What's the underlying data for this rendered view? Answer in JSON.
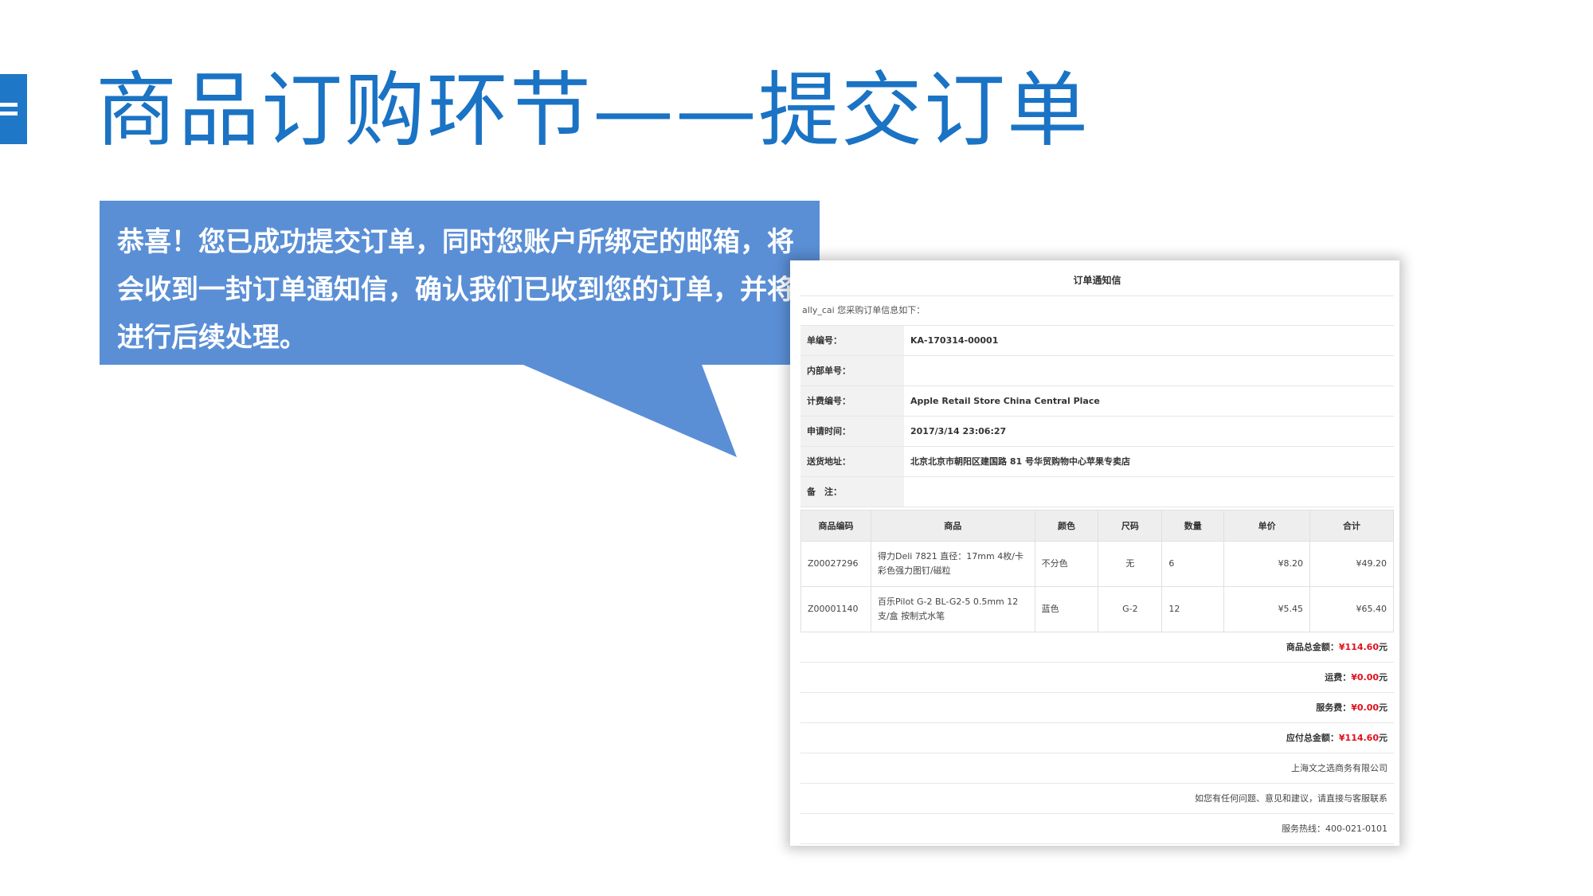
{
  "slide": {
    "title": "商品订购环节——提交订单",
    "callout": "恭喜！您已成功提交订单，同时您账户所绑定的邮箱，将会收到一封订单通知信，确认我们已收到您的订单，并将进行后续处理。",
    "accent_color": "#1f77c8",
    "callout_color": "#5a8fd6"
  },
  "email": {
    "title": "订单通知信",
    "greeting": "ally_cai 您采购订单信息如下：",
    "info": [
      {
        "label": "单编号：",
        "value": "KA-170314-00001"
      },
      {
        "label": "内部单号：",
        "value": ""
      },
      {
        "label": "计费编号：",
        "value": "Apple Retail Store China Central Place"
      },
      {
        "label": "申请时间：",
        "value": "2017/3/14 23:06:27"
      },
      {
        "label": "送货地址：",
        "value": "北京北京市朝阳区建国路 81 号华贸购物中心苹果专卖店"
      },
      {
        "label": "备　注：",
        "value": ""
      }
    ],
    "columns": [
      "商品编码",
      "商品",
      "颜色",
      "尺码",
      "数量",
      "单价",
      "合计"
    ],
    "rows": [
      {
        "code": "Z00027296",
        "name": "得力Deli 7821 直径：17mm 4枚/卡 彩色强力图钉/磁粒",
        "color": "不分色",
        "size": "无",
        "qty": "6",
        "price": "¥8.20",
        "total": "¥49.20"
      },
      {
        "code": "Z00001140",
        "name": "百乐Pilot G-2 BL-G2-5 0.5mm 12支/盒 按制式水笔",
        "color": "蓝色",
        "size": "G-2",
        "qty": "12",
        "price": "¥5.45",
        "total": "¥65.40"
      }
    ],
    "summary": [
      {
        "label": "商品总金额：",
        "amount": "¥114.60",
        "unit": "元"
      },
      {
        "label": "运费：",
        "amount": "¥0.00",
        "unit": "元"
      },
      {
        "label": "服务费：",
        "amount": "¥0.00",
        "unit": "元"
      },
      {
        "label": "应付总金额：",
        "amount": "¥114.60",
        "unit": "元"
      }
    ],
    "footer": {
      "company": "上海文之选商务有限公司",
      "note": "如您有任何问题、意见和建议，请直接与客服联系",
      "hotline": "服务热线：400-021-0101"
    }
  }
}
